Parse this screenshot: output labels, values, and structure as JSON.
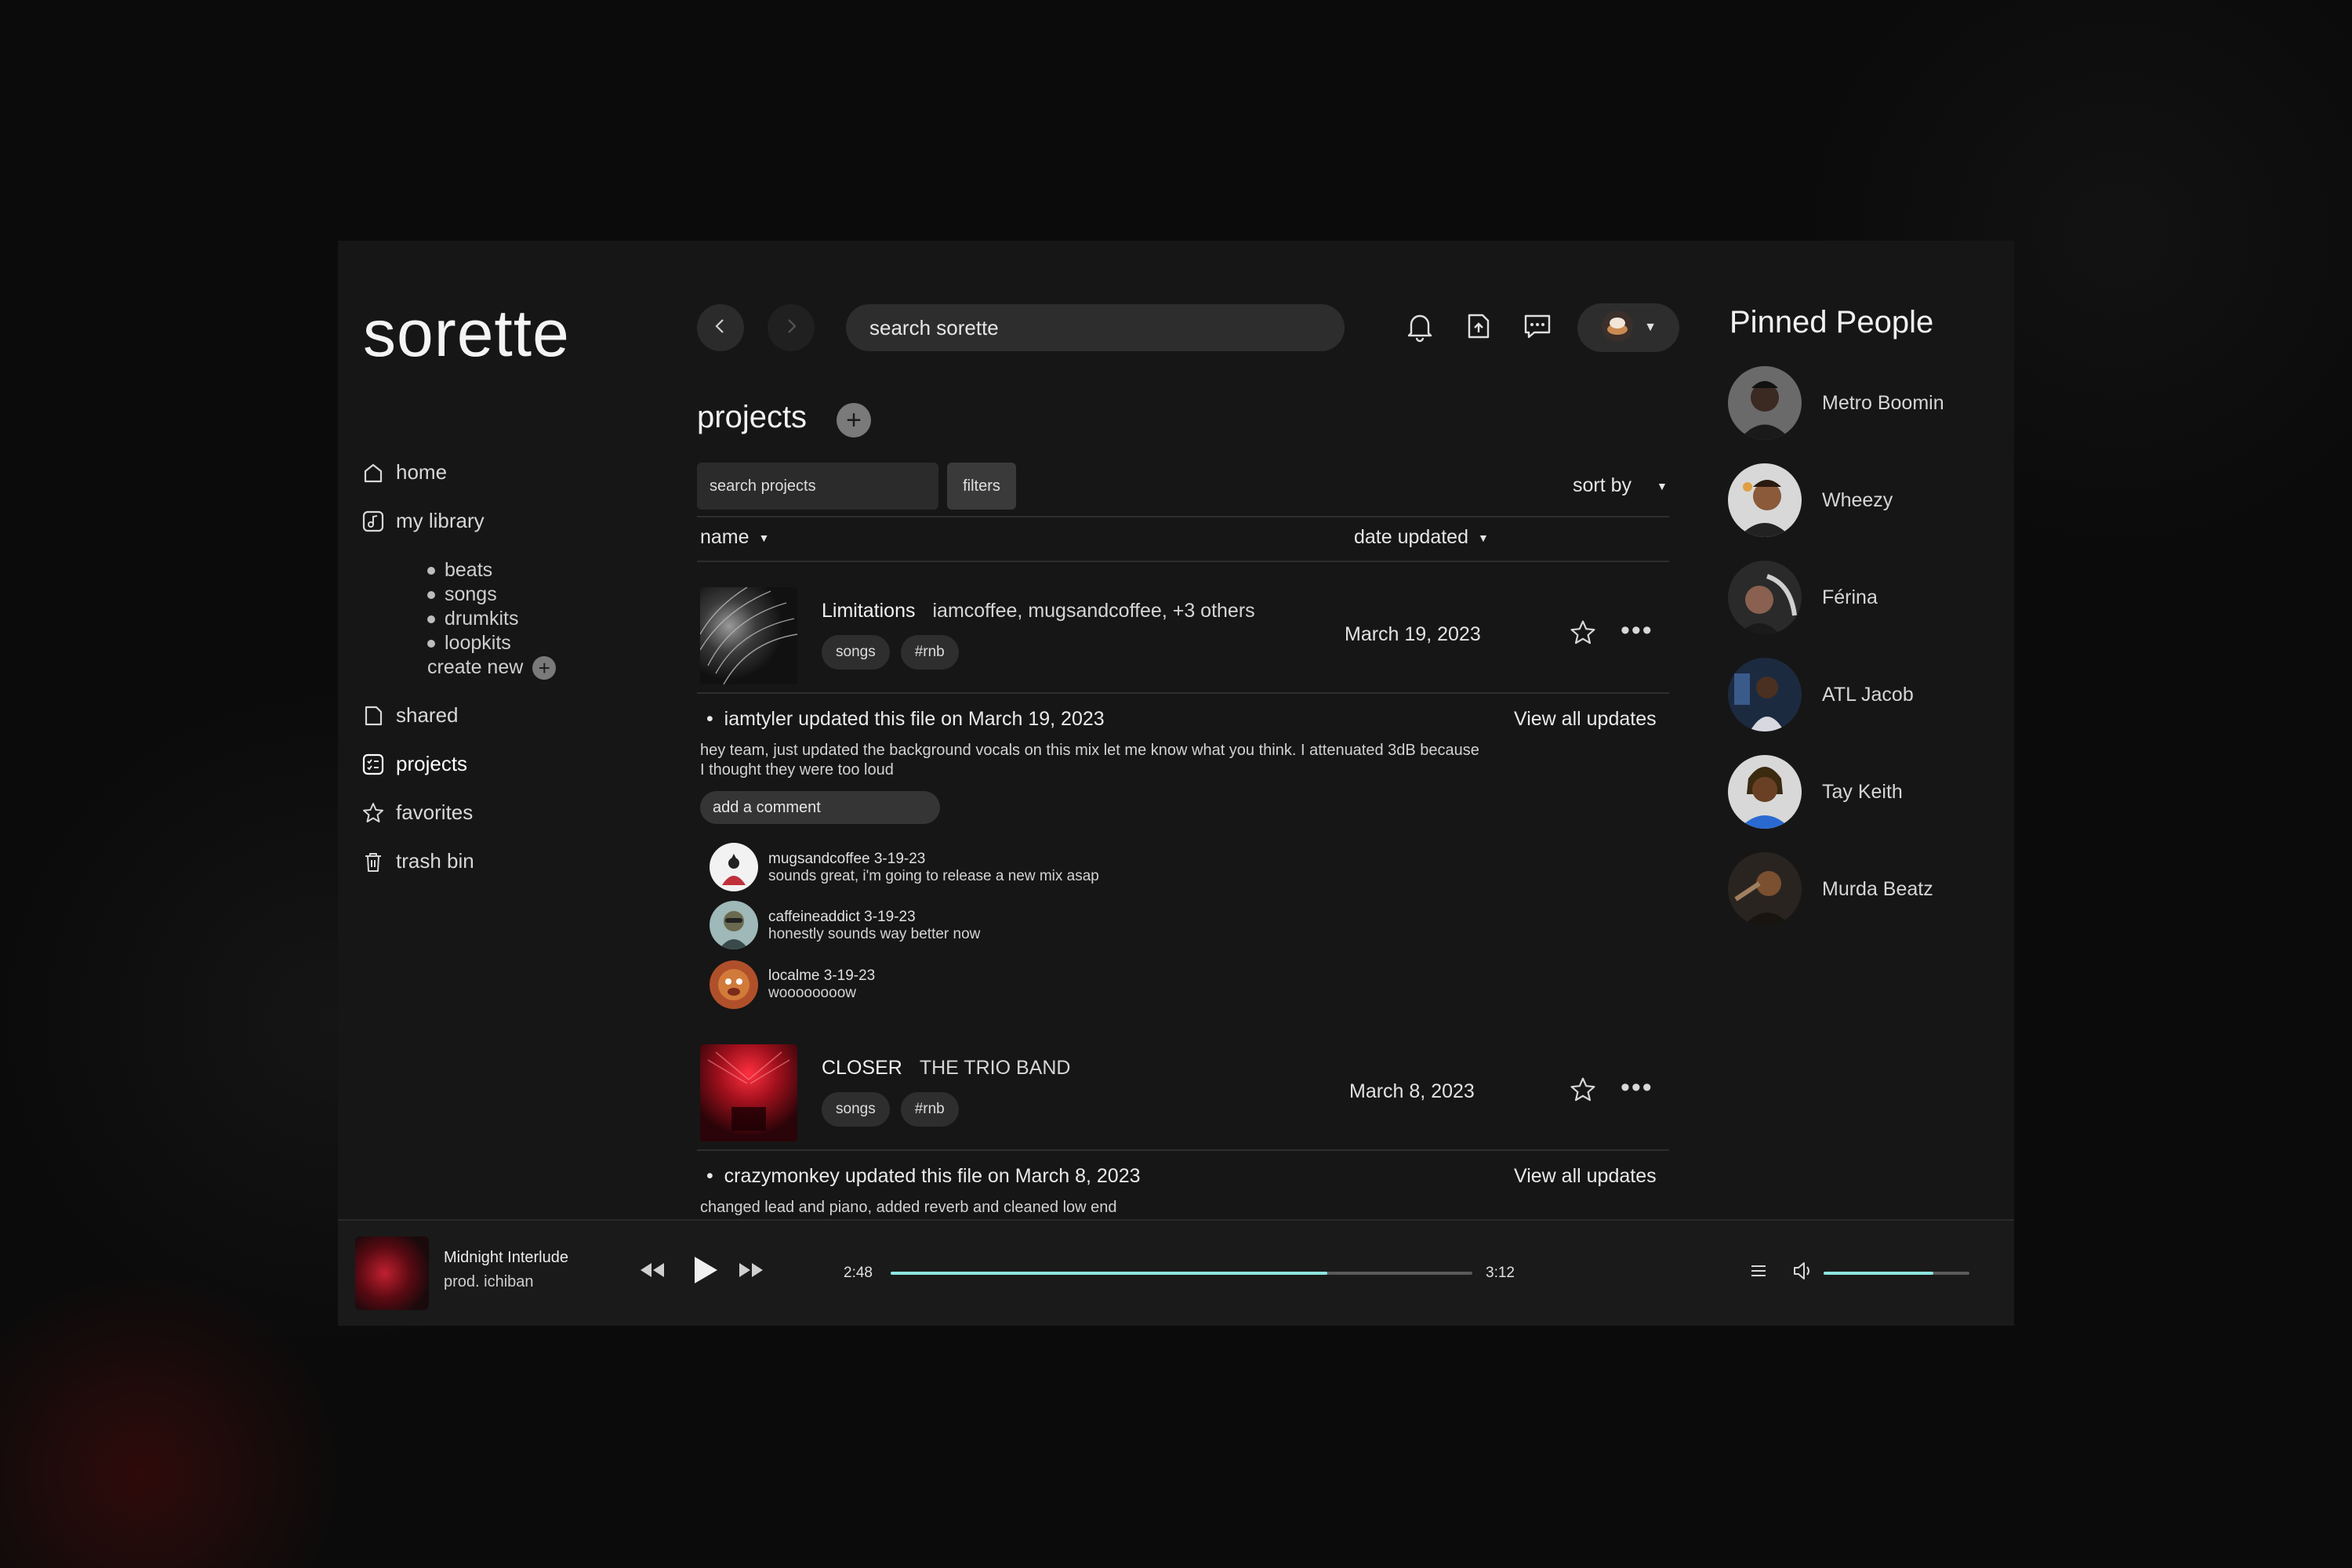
{
  "app": {
    "name": "sorette"
  },
  "colors": {
    "accent": "#8ee6e0",
    "background": "#161616",
    "surface": "#2d2d2d"
  },
  "sidebar": {
    "items": [
      {
        "label": "home",
        "icon": "home-icon"
      },
      {
        "label": "my library",
        "icon": "music-library-icon"
      },
      {
        "label": "shared",
        "icon": "file-icon"
      },
      {
        "label": "projects",
        "icon": "projects-icon"
      },
      {
        "label": "favorites",
        "icon": "star-icon"
      },
      {
        "label": "trash bin",
        "icon": "trash-icon"
      }
    ],
    "library_sub": [
      "beats",
      "songs",
      "drumkits",
      "loopkits"
    ],
    "create_new": "create new"
  },
  "topbar": {
    "search_placeholder": "search sorette",
    "icons": [
      "back-arrow-icon",
      "forward-arrow-icon",
      "bell-icon",
      "upload-file-icon",
      "chat-icon",
      "profile-avatar"
    ]
  },
  "projects": {
    "title": "projects",
    "search_placeholder": "search projects",
    "filters_label": "filters",
    "sort_label": "sort by",
    "columns": {
      "name": "name",
      "date": "date updated"
    },
    "items": [
      {
        "title": "Limitations",
        "collaborators": "iamcoffee, mugsandcoffee, +3 others",
        "tags": [
          "songs",
          "#rnb"
        ],
        "date": "March 19, 2023",
        "update": "iamtyler updated this file on March 19, 2023",
        "view_all": "View all updates",
        "message": "hey team, just updated the background vocals on this mix let me know what you think. I attenuated 3dB because I thought they were too loud",
        "comment_placeholder": "add a comment",
        "comments": [
          {
            "user_date": "mugsandcoffee 3-19-23",
            "text": "sounds great, i'm going to release a new mix asap"
          },
          {
            "user_date": "caffeineaddict 3-19-23",
            "text": "honestly sounds way better now"
          },
          {
            "user_date": "localme 3-19-23",
            "text": "woooooooow"
          }
        ]
      },
      {
        "title": "CLOSER",
        "collaborators": "THE TRIO BAND",
        "tags": [
          "songs",
          "#rnb"
        ],
        "date": "March 8, 2023",
        "update": "crazymonkey updated this file on March 8, 2023",
        "view_all": "View all updates",
        "message": "changed lead and piano, added reverb and cleaned low end"
      }
    ]
  },
  "pinned": {
    "title": "Pinned People",
    "people": [
      "Metro Boomin",
      "Wheezy",
      "Férina",
      "ATL Jacob",
      "Tay Keith",
      "Murda Beatz"
    ]
  },
  "player": {
    "title": "Midnight Interlude",
    "subtitle": "prod. ichiban",
    "elapsed": "2:48",
    "duration": "3:12",
    "progress_fraction": 0.75,
    "volume_fraction": 0.75
  }
}
